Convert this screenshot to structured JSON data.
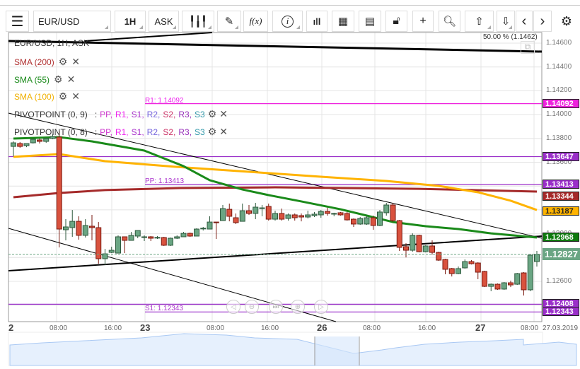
{
  "toolbar": {
    "symbol": "EUR/USD",
    "timeframe": "1H",
    "price_type": "ASK",
    "icons": [
      "menu-icon",
      "candlestick-icon",
      "pen-icon",
      "function-icon",
      "info-icon",
      "bar-chart-icon",
      "calendar-icon",
      "document-icon",
      "lock-icon",
      "crosshair-icon",
      "zoom-icon",
      "upload-icon",
      "download-icon",
      "chevron-left-icon",
      "chevron-right-icon",
      "gear-icon"
    ],
    "fx": "f(x)",
    "info": "i"
  },
  "legend": {
    "title": "EUR/USD, 1H, ASK",
    "sma200": "SMA (200)",
    "sma55": "SMA (55)",
    "sma100": "SMA (100)",
    "pivot9": "PIVOTPOINT (0, 9)",
    "pivot8": "PIVOTPOINT (0, 8)",
    "pivot_parts": [
      ":",
      "PP,",
      "R1,",
      "S1,",
      "R2,",
      "S2,",
      "R3,",
      "S3"
    ]
  },
  "fib_label": "50.00 % (1.1462)",
  "colors": {
    "sma200": "#a52a2a",
    "sma55": "#1a8a1a",
    "sma100": "#ffb300",
    "pivot": "#9a2fc9",
    "r1": "#ee22dd",
    "up": "#6aa583",
    "down": "#d9523e",
    "pp": "#cc33cc",
    "r1c": "#ee22ee",
    "s1": "#aa33cc",
    "r2": "#7766dd",
    "s2": "#cc3366",
    "r3": "#9933bb",
    "s3": "#3399aa"
  },
  "y_ticks": [
    "1.14600",
    "1.14400",
    "1.14200",
    "1.14000",
    "1.13800",
    "1.13600",
    "1.13000",
    "1.12600"
  ],
  "price_labels": {
    "r1": "1.14092",
    "l13647": "1.13647",
    "pp": "1.13413",
    "sma200": "1.13344",
    "sma100": "1.13187",
    "sma55": "1.12968",
    "last": "1.12827",
    "l12408": "1.12408",
    "s1": "1.12343"
  },
  "pivot_text": {
    "r1": "R1: 1.14092",
    "pp": "PP: 1.13413",
    "s1": "S1: 1.12343"
  },
  "x_ticks": [
    "2",
    "08:00",
    "16:00",
    "23",
    "08:00",
    "16:00",
    "26",
    "08:00",
    "16:00",
    "27",
    "08:00",
    "27.03.2019"
  ],
  "chart_data": {
    "type": "candlestick",
    "ylim": [
      1.1228,
      1.1468
    ],
    "candles": [
      [
        1.13733,
        1.13775,
        1.1365,
        1.13763
      ],
      [
        1.13757,
        1.13769,
        1.13721,
        1.13733
      ],
      [
        1.13739,
        1.13751,
        1.13727,
        1.13757
      ],
      [
        1.13763,
        1.13799,
        1.13757,
        1.13793
      ],
      [
        1.13787,
        1.13799,
        1.13757,
        1.13775
      ],
      [
        1.13775,
        1.13805,
        1.13763,
        1.13799
      ],
      [
        1.13799,
        1.13835,
        1.13793,
        1.13817
      ],
      [
        1.13811,
        1.13864,
        1.12885,
        1.13039
      ],
      [
        1.13033,
        1.13122,
        1.12944,
        1.13057
      ],
      [
        1.13051,
        1.13199,
        1.12974,
        1.13104
      ],
      [
        1.13104,
        1.13146,
        1.1295,
        1.12986
      ],
      [
        1.12986,
        1.13122,
        1.12968,
        1.13069
      ],
      [
        1.13063,
        1.13158,
        1.12944,
        1.13051
      ],
      [
        1.13051,
        1.13098,
        1.12748,
        1.1279
      ],
      [
        1.1279,
        1.12873,
        1.12736,
        1.12831
      ],
      [
        1.12843,
        1.12891,
        1.12837,
        1.12861
      ],
      [
        1.12837,
        1.12986,
        1.12837,
        1.12974
      ],
      [
        1.12974,
        1.12974,
        1.12837,
        1.12944
      ],
      [
        1.12944,
        1.13015,
        1.12944,
        1.12986
      ],
      [
        1.1298,
        1.13027,
        1.12962,
        1.13027
      ],
      [
        1.12968,
        1.12986,
        1.12938,
        1.12974
      ],
      [
        1.12974,
        1.1298,
        1.12938,
        1.12962
      ],
      [
        1.12968,
        1.1298,
        1.12956,
        1.12969
      ],
      [
        1.12968,
        1.12974,
        1.12897,
        1.12903
      ],
      [
        1.12903,
        1.12968,
        1.12897,
        1.12962
      ],
      [
        1.12962,
        1.12986,
        1.12956,
        1.12974
      ],
      [
        1.12974,
        1.13015,
        1.12974,
        1.13003
      ],
      [
        1.13003,
        1.13009,
        1.12974,
        1.1298
      ],
      [
        1.1298,
        1.13045,
        1.1298,
        1.13039
      ],
      [
        1.13045,
        1.13057,
        1.13027,
        1.13046
      ],
      [
        1.13039,
        1.13146,
        1.13039,
        1.13098
      ],
      [
        1.13098,
        1.13098,
        1.12956,
        1.13093
      ],
      [
        1.1311,
        1.13241,
        1.1311,
        1.13211
      ],
      [
        1.13205,
        1.13253,
        1.13104,
        1.13146
      ],
      [
        1.13134,
        1.1317,
        1.13081,
        1.13093
      ],
      [
        1.13104,
        1.13253,
        1.13104,
        1.13193
      ],
      [
        1.13193,
        1.13241,
        1.13158,
        1.1317
      ],
      [
        1.1317,
        1.13259,
        1.13122,
        1.13223
      ],
      [
        1.13217,
        1.13241,
        1.13146,
        1.13217
      ],
      [
        1.13229,
        1.13253,
        1.1311,
        1.13122
      ],
      [
        1.13122,
        1.13193,
        1.1311,
        1.1317
      ],
      [
        1.1317,
        1.13211,
        1.1311,
        1.13122
      ],
      [
        1.13128,
        1.1317,
        1.1311,
        1.13158
      ],
      [
        1.13158,
        1.1317,
        1.1311,
        1.13134
      ],
      [
        1.13152,
        1.1317,
        1.13104,
        1.1314
      ],
      [
        1.1314,
        1.13193,
        1.13128,
        1.13158
      ],
      [
        1.13152,
        1.13182,
        1.1314,
        1.13164
      ],
      [
        1.13158,
        1.13199,
        1.13134,
        1.13187
      ],
      [
        1.13187,
        1.13217,
        1.13152,
        1.1317
      ],
      [
        1.13164,
        1.13176,
        1.13146,
        1.1317
      ],
      [
        1.13176,
        1.13182,
        1.13152,
        1.13158
      ],
      [
        1.1317,
        1.13182,
        1.1311,
        1.13116
      ],
      [
        1.13122,
        1.13128,
        1.13057,
        1.13081
      ],
      [
        1.13081,
        1.1314,
        1.13075,
        1.13128
      ],
      [
        1.13081,
        1.13152,
        1.13075,
        1.13134
      ],
      [
        1.13134,
        1.13152,
        1.13033,
        1.13069
      ],
      [
        1.13069,
        1.13199,
        1.13063,
        1.13182
      ],
      [
        1.13176,
        1.13259,
        1.13152,
        1.13241
      ],
      [
        1.13241,
        1.13259,
        1.13098,
        1.1311
      ],
      [
        1.1311,
        1.13116,
        1.12855,
        1.12885
      ],
      [
        1.12891,
        1.1292,
        1.12801,
        1.12861
      ],
      [
        1.12861,
        1.13003,
        1.12849,
        1.12986
      ],
      [
        1.12986,
        1.12992,
        1.12843,
        1.12849
      ],
      [
        1.12849,
        1.12903,
        1.12843,
        1.12897
      ],
      [
        1.12897,
        1.12944,
        1.12825,
        1.12843
      ],
      [
        1.12843,
        1.12849,
        1.12772,
        1.12778
      ],
      [
        1.12784,
        1.1279,
        1.12659,
        1.12701
      ],
      [
        1.12707,
        1.12713,
        1.12641,
        1.12665
      ],
      [
        1.12665,
        1.12725,
        1.12659,
        1.12707
      ],
      [
        1.12713,
        1.12784,
        1.12707,
        1.12766
      ],
      [
        1.12766,
        1.12778,
        1.12742,
        1.12748
      ],
      [
        1.12754,
        1.1276,
        1.12618,
        1.12677
      ],
      [
        1.12683,
        1.12689,
        1.12552,
        1.12558
      ],
      [
        1.12558,
        1.12582,
        1.12517,
        1.12576
      ],
      [
        1.12576,
        1.12582,
        1.12529,
        1.12535
      ],
      [
        1.12535,
        1.12594,
        1.12529,
        1.12588
      ],
      [
        1.12588,
        1.12606,
        1.12552,
        1.1257
      ],
      [
        1.12576,
        1.12671,
        1.1257,
        1.12665
      ],
      [
        1.12671,
        1.12677,
        1.12481,
        1.12529
      ],
      [
        1.12529,
        1.12831,
        1.12517,
        1.1282
      ],
      [
        1.12766,
        1.12855,
        1.12724,
        1.12827
      ]
    ],
    "sma55": [
      [
        0,
        1.13799
      ],
      [
        7,
        1.13811
      ],
      [
        12,
        1.13775
      ],
      [
        20,
        1.13698
      ],
      [
        26,
        1.13567
      ],
      [
        30,
        1.13449
      ],
      [
        35,
        1.13371
      ],
      [
        39,
        1.13324
      ],
      [
        44,
        1.13271
      ],
      [
        50,
        1.13205
      ],
      [
        54,
        1.13152
      ],
      [
        58,
        1.13098
      ],
      [
        63,
        1.13063
      ],
      [
        68,
        1.13039
      ],
      [
        73,
        1.13003
      ],
      [
        80,
        1.12968
      ]
    ],
    "sma100": [
      [
        0,
        1.13645
      ],
      [
        7,
        1.13668
      ],
      [
        14,
        1.13609
      ],
      [
        25,
        1.13561
      ],
      [
        36,
        1.1352
      ],
      [
        47,
        1.13478
      ],
      [
        57,
        1.13443
      ],
      [
        65,
        1.13401
      ],
      [
        71,
        1.13348
      ],
      [
        76,
        1.13277
      ],
      [
        80,
        1.13199
      ]
    ],
    "sma200": [
      [
        0,
        1.13306
      ],
      [
        7,
        1.13342
      ],
      [
        14,
        1.13366
      ],
      [
        25,
        1.13383
      ],
      [
        40,
        1.13389
      ],
      [
        62,
        1.13377
      ],
      [
        80,
        1.13354
      ]
    ],
    "levels": {
      "r1": 1.14092,
      "l13647": 1.13647,
      "pp": 1.13413,
      "l12408": 1.12408,
      "s1": 1.12343,
      "last": 1.12827
    }
  }
}
